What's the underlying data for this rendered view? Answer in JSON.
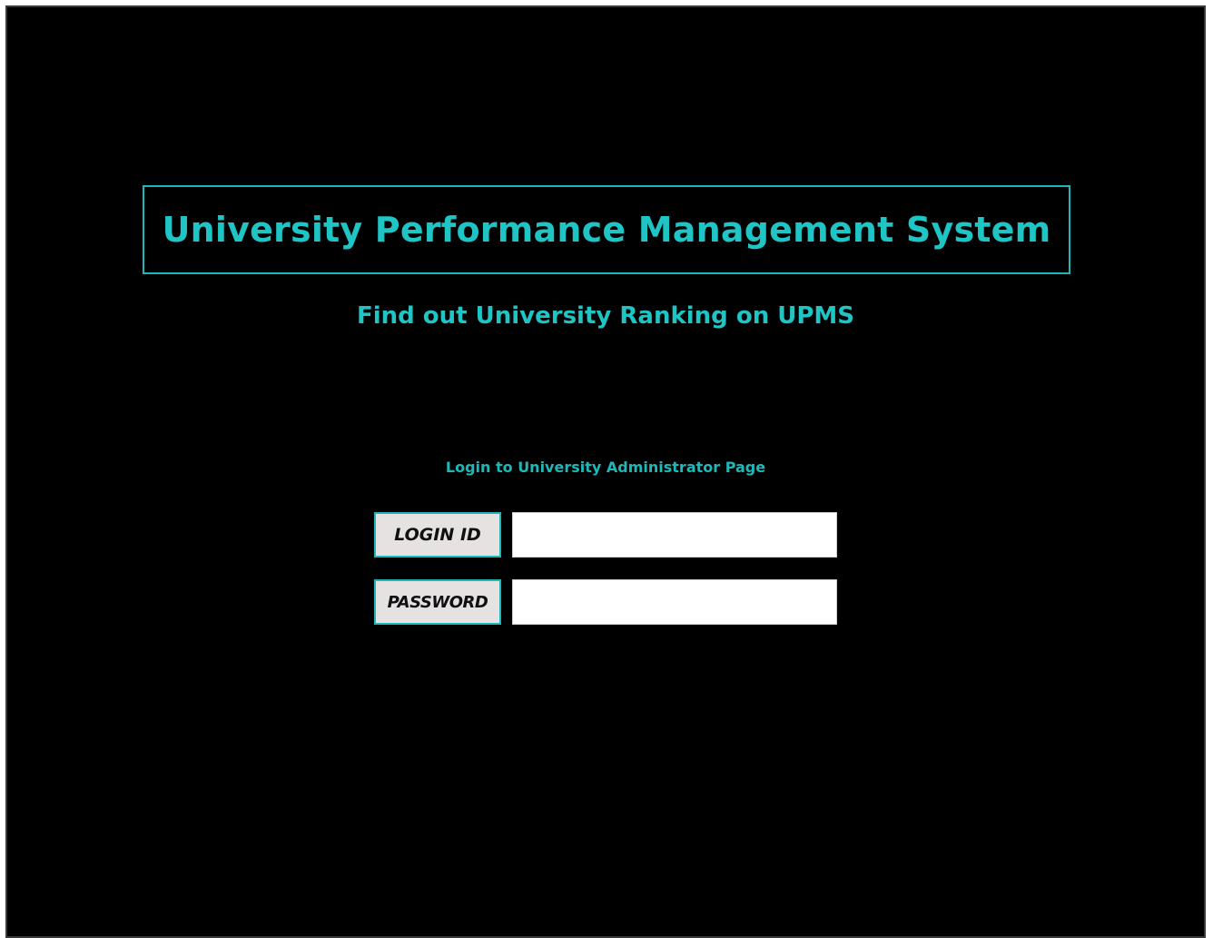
{
  "header": {
    "title": "University Performance Management System",
    "subtitle": "Find out University Ranking on UPMS"
  },
  "login": {
    "heading": "Login to University Administrator Page",
    "login_id_label": "LOGIN ID",
    "login_id_value": "",
    "password_label": "PASSWORD",
    "password_value": ""
  },
  "colors": {
    "background": "#000000",
    "accent": "#1fc4c4",
    "label_bg": "#e6e2e2",
    "input_bg": "#ffffff"
  }
}
